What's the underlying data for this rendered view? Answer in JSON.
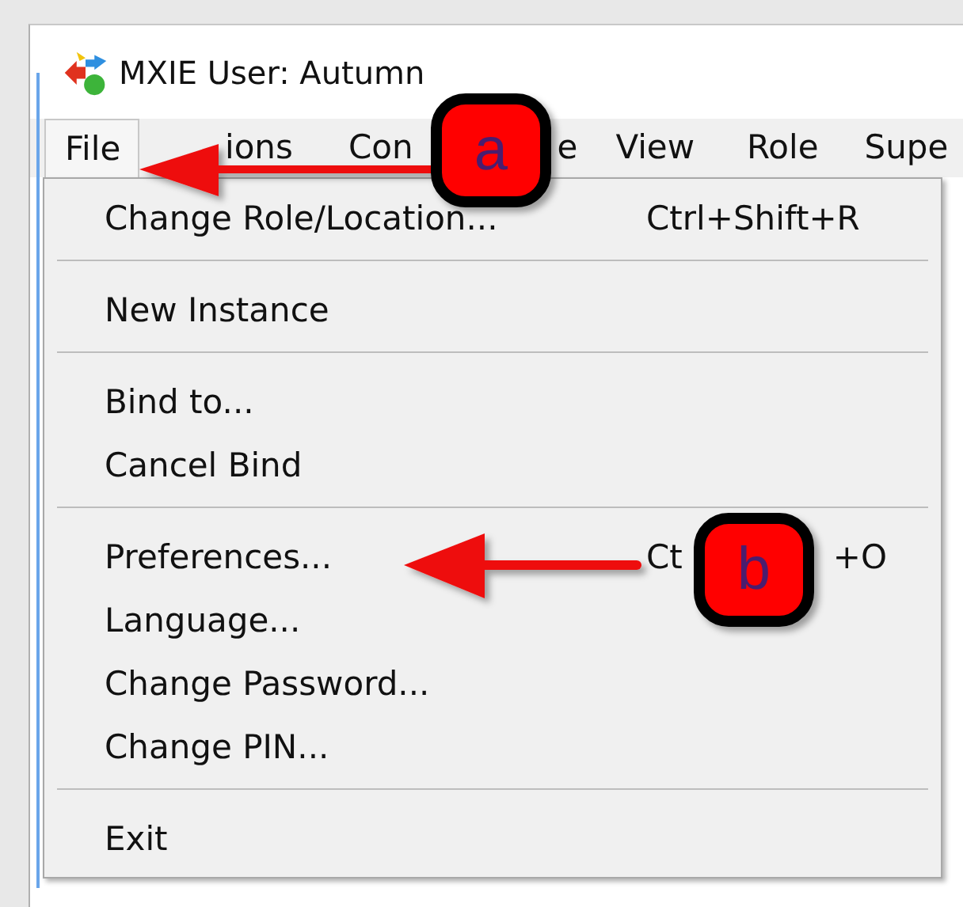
{
  "window": {
    "title": "MXIE User: Autumn"
  },
  "menu_bar": [
    {
      "label": "File",
      "selected": true
    },
    {
      "label": "ions",
      "selected": false
    },
    {
      "label": "Con",
      "selected": false
    },
    {
      "label": "e",
      "selected": false
    },
    {
      "label": "View",
      "selected": false
    },
    {
      "label": "Role",
      "selected": false
    },
    {
      "label": "Supe",
      "selected": false
    }
  ],
  "file_menu": [
    {
      "kind": "item",
      "label": "Change Role/Location...",
      "shortcut_parts": [
        "Ctrl+Shift+R"
      ]
    },
    {
      "kind": "separator"
    },
    {
      "kind": "item",
      "label": "New Instance"
    },
    {
      "kind": "separator"
    },
    {
      "kind": "item",
      "label": "Bind to..."
    },
    {
      "kind": "item",
      "label": "Cancel Bind"
    },
    {
      "kind": "separator"
    },
    {
      "kind": "item",
      "label": "Preferences...",
      "shortcut_parts": [
        "Ct",
        "+O"
      ]
    },
    {
      "kind": "item",
      "label": "Language..."
    },
    {
      "kind": "item",
      "label": "Change Password..."
    },
    {
      "kind": "item",
      "label": "Change PIN..."
    },
    {
      "kind": "separator"
    },
    {
      "kind": "item",
      "label": "Exit"
    }
  ],
  "annotations": [
    {
      "label": "a"
    },
    {
      "label": "b"
    }
  ]
}
